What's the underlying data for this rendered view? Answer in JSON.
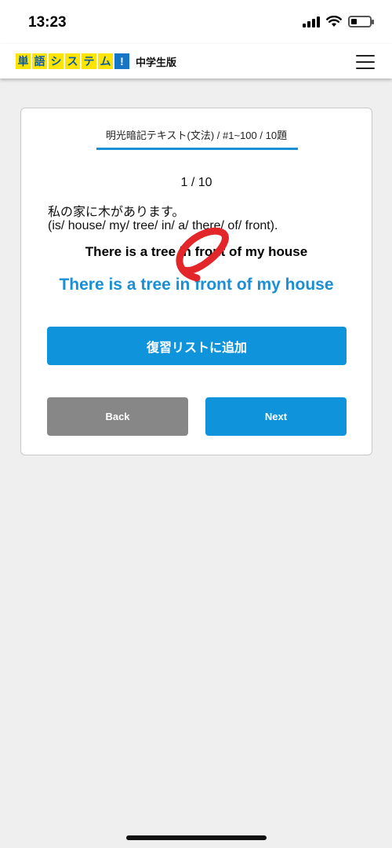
{
  "status_bar": {
    "time": "13:23",
    "icons": [
      "signal-icon",
      "wifi-icon",
      "battery-icon"
    ],
    "battery_level": 0.3
  },
  "header": {
    "logo_tiles": [
      "単",
      "語",
      "シ",
      "ス",
      "テ",
      "ム",
      "!"
    ],
    "edition": "中学生版",
    "menu_icon": "hamburger-menu-icon"
  },
  "card": {
    "title": "明光暗記テキスト(文法) / #1~100 / 10題",
    "progress": "1 / 10",
    "question_jp": "私の家に木があります。",
    "question_words": "(is/ house/ my/ tree/ in/ a/ there/ of/ front).",
    "user_answer": "There is a tree in front of my house",
    "correct_answer": "There is a tree in front of my house",
    "mark_icon": "correct-circle-icon",
    "review_button": "復習リストに追加",
    "back_button": "Back",
    "next_button": "Next"
  },
  "colors": {
    "accent": "#0f94dc",
    "correct_text": "#1b8fd6",
    "mark": "#e2262a",
    "back_button": "#878787",
    "logo_yellow": "#ffe400"
  }
}
